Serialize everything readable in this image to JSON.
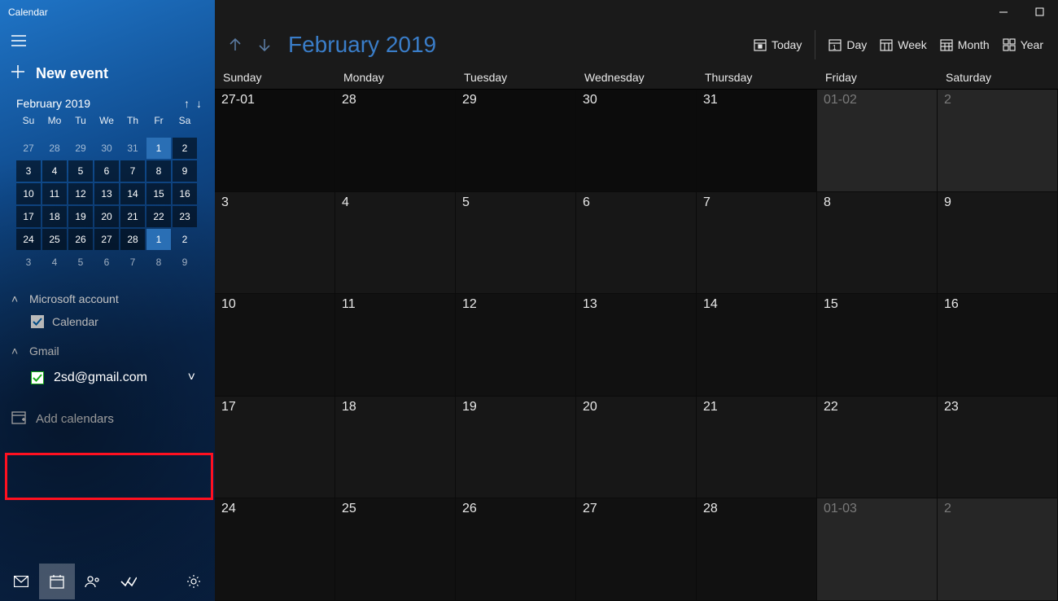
{
  "app": {
    "title": "Calendar"
  },
  "sidebar": {
    "new_event": "New event",
    "mini": {
      "title": "February 2019",
      "dows": [
        "Su",
        "Mo",
        "Tu",
        "We",
        "Th",
        "Fr",
        "Sa"
      ],
      "rows": [
        [
          {
            "n": "27",
            "cls": "out"
          },
          {
            "n": "28",
            "cls": "out"
          },
          {
            "n": "29",
            "cls": "out"
          },
          {
            "n": "30",
            "cls": "out"
          },
          {
            "n": "31",
            "cls": "out"
          },
          {
            "n": "1",
            "cls": "cur sel"
          },
          {
            "n": "2",
            "cls": "cur"
          }
        ],
        [
          {
            "n": "3",
            "cls": "cur"
          },
          {
            "n": "4",
            "cls": "cur"
          },
          {
            "n": "5",
            "cls": "cur"
          },
          {
            "n": "6",
            "cls": "cur"
          },
          {
            "n": "7",
            "cls": "cur"
          },
          {
            "n": "8",
            "cls": "cur"
          },
          {
            "n": "9",
            "cls": "cur"
          }
        ],
        [
          {
            "n": "10",
            "cls": "cur"
          },
          {
            "n": "11",
            "cls": "cur"
          },
          {
            "n": "12",
            "cls": "cur"
          },
          {
            "n": "13",
            "cls": "cur"
          },
          {
            "n": "14",
            "cls": "cur"
          },
          {
            "n": "15",
            "cls": "cur"
          },
          {
            "n": "16",
            "cls": "cur"
          }
        ],
        [
          {
            "n": "17",
            "cls": "cur"
          },
          {
            "n": "18",
            "cls": "cur"
          },
          {
            "n": "19",
            "cls": "cur"
          },
          {
            "n": "20",
            "cls": "cur"
          },
          {
            "n": "21",
            "cls": "cur"
          },
          {
            "n": "22",
            "cls": "cur"
          },
          {
            "n": "23",
            "cls": "cur"
          }
        ],
        [
          {
            "n": "24",
            "cls": "cur"
          },
          {
            "n": "25",
            "cls": "cur"
          },
          {
            "n": "26",
            "cls": "cur"
          },
          {
            "n": "27",
            "cls": "cur"
          },
          {
            "n": "28",
            "cls": "cur"
          },
          {
            "n": "1",
            "cls": "sel"
          },
          {
            "n": "2",
            "cls": ""
          }
        ],
        [
          {
            "n": "3",
            "cls": "out"
          },
          {
            "n": "4",
            "cls": "out"
          },
          {
            "n": "5",
            "cls": "out"
          },
          {
            "n": "6",
            "cls": "out"
          },
          {
            "n": "7",
            "cls": "out"
          },
          {
            "n": "8",
            "cls": "out"
          },
          {
            "n": "9",
            "cls": "out"
          }
        ]
      ]
    },
    "accounts": {
      "ms": {
        "label": "Microsoft account",
        "item": "Calendar"
      },
      "gmail": {
        "label": "Gmail",
        "item": "2sd@gmail.com"
      }
    },
    "add_calendars": "Add calendars"
  },
  "main": {
    "title": "February 2019",
    "views": {
      "today": "Today",
      "day": "Day",
      "week": "Week",
      "month": "Month",
      "year": "Year"
    },
    "dows": [
      "Sunday",
      "Monday",
      "Tuesday",
      "Wednesday",
      "Thursday",
      "Friday",
      "Saturday"
    ],
    "cells": [
      [
        {
          "t": "27-01",
          "cls": "dark"
        },
        {
          "t": "28",
          "cls": "dark"
        },
        {
          "t": "29",
          "cls": "dark"
        },
        {
          "t": "30",
          "cls": "dark"
        },
        {
          "t": "31",
          "cls": "dark"
        },
        {
          "t": "01-02",
          "cls": "outm"
        },
        {
          "t": "2",
          "cls": "outm"
        }
      ],
      [
        {
          "t": "3",
          "cls": "alt"
        },
        {
          "t": "4",
          "cls": "alt"
        },
        {
          "t": "5",
          "cls": "alt"
        },
        {
          "t": "6",
          "cls": "alt"
        },
        {
          "t": "7",
          "cls": "alt"
        },
        {
          "t": "8",
          "cls": "alt"
        },
        {
          "t": "9",
          "cls": "alt"
        }
      ],
      [
        {
          "t": "10",
          "cls": ""
        },
        {
          "t": "11",
          "cls": ""
        },
        {
          "t": "12",
          "cls": ""
        },
        {
          "t": "13",
          "cls": ""
        },
        {
          "t": "14",
          "cls": ""
        },
        {
          "t": "15",
          "cls": ""
        },
        {
          "t": "16",
          "cls": ""
        }
      ],
      [
        {
          "t": "17",
          "cls": "alt"
        },
        {
          "t": "18",
          "cls": "alt"
        },
        {
          "t": "19",
          "cls": "alt"
        },
        {
          "t": "20",
          "cls": "alt"
        },
        {
          "t": "21",
          "cls": "alt"
        },
        {
          "t": "22",
          "cls": "alt"
        },
        {
          "t": "23",
          "cls": "alt"
        }
      ],
      [
        {
          "t": "24",
          "cls": ""
        },
        {
          "t": "25",
          "cls": ""
        },
        {
          "t": "26",
          "cls": ""
        },
        {
          "t": "27",
          "cls": ""
        },
        {
          "t": "28",
          "cls": ""
        },
        {
          "t": "01-03",
          "cls": "outm"
        },
        {
          "t": "2",
          "cls": "outm"
        }
      ]
    ]
  }
}
